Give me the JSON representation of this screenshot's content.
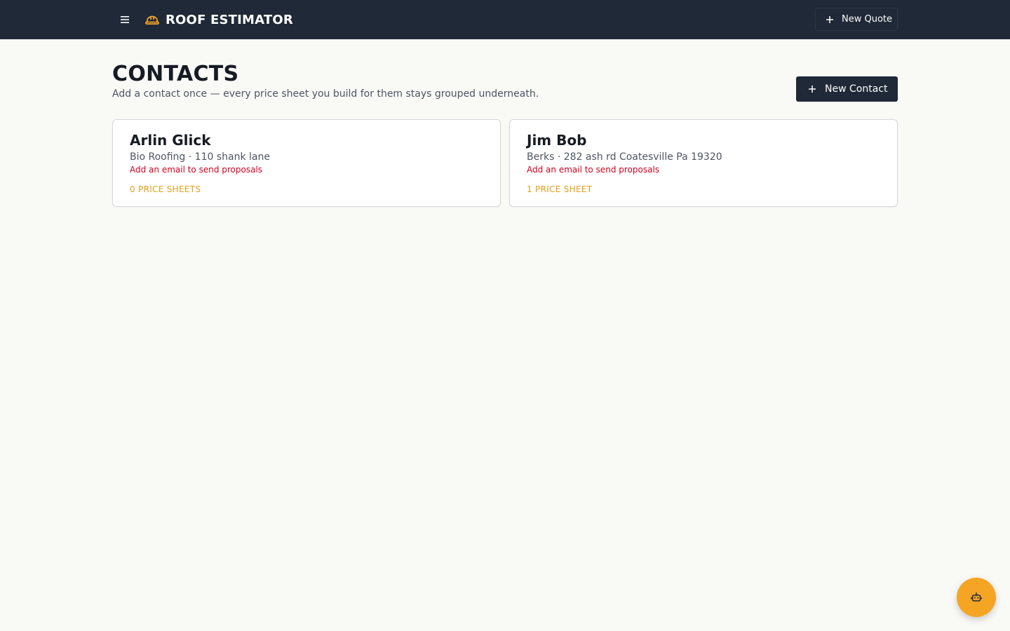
{
  "header": {
    "title": "ROOF ESTIMATOR",
    "new_quote_label": "New Quote",
    "menu_icon": "hamburger-menu-icon",
    "brand_icon": "hard-hat-icon"
  },
  "page": {
    "title": "CONTACTS",
    "subtitle": "Add a contact once — every price sheet you build for them stays grouped underneath.",
    "new_contact_label": "New Contact"
  },
  "contacts": [
    {
      "name": "Arlin Glick",
      "meta": "Bio Roofing · 110 shank lane",
      "warning": "Add an email to send proposals",
      "price_sheets": "0 PRICE SHEETS"
    },
    {
      "name": "Jim Bob",
      "meta": "Berks · 282 ash rd Coatesville Pa 19320",
      "warning": "Add an email to send proposals",
      "price_sheets": "1 PRICE SHEET"
    }
  ],
  "assistant": {
    "icon": "robot-icon"
  },
  "colors": {
    "header_bg": "#1f2937",
    "accent": "#f5a524",
    "warning": "#d1001f",
    "count": "#e5a019",
    "background": "#f9f9f6"
  }
}
